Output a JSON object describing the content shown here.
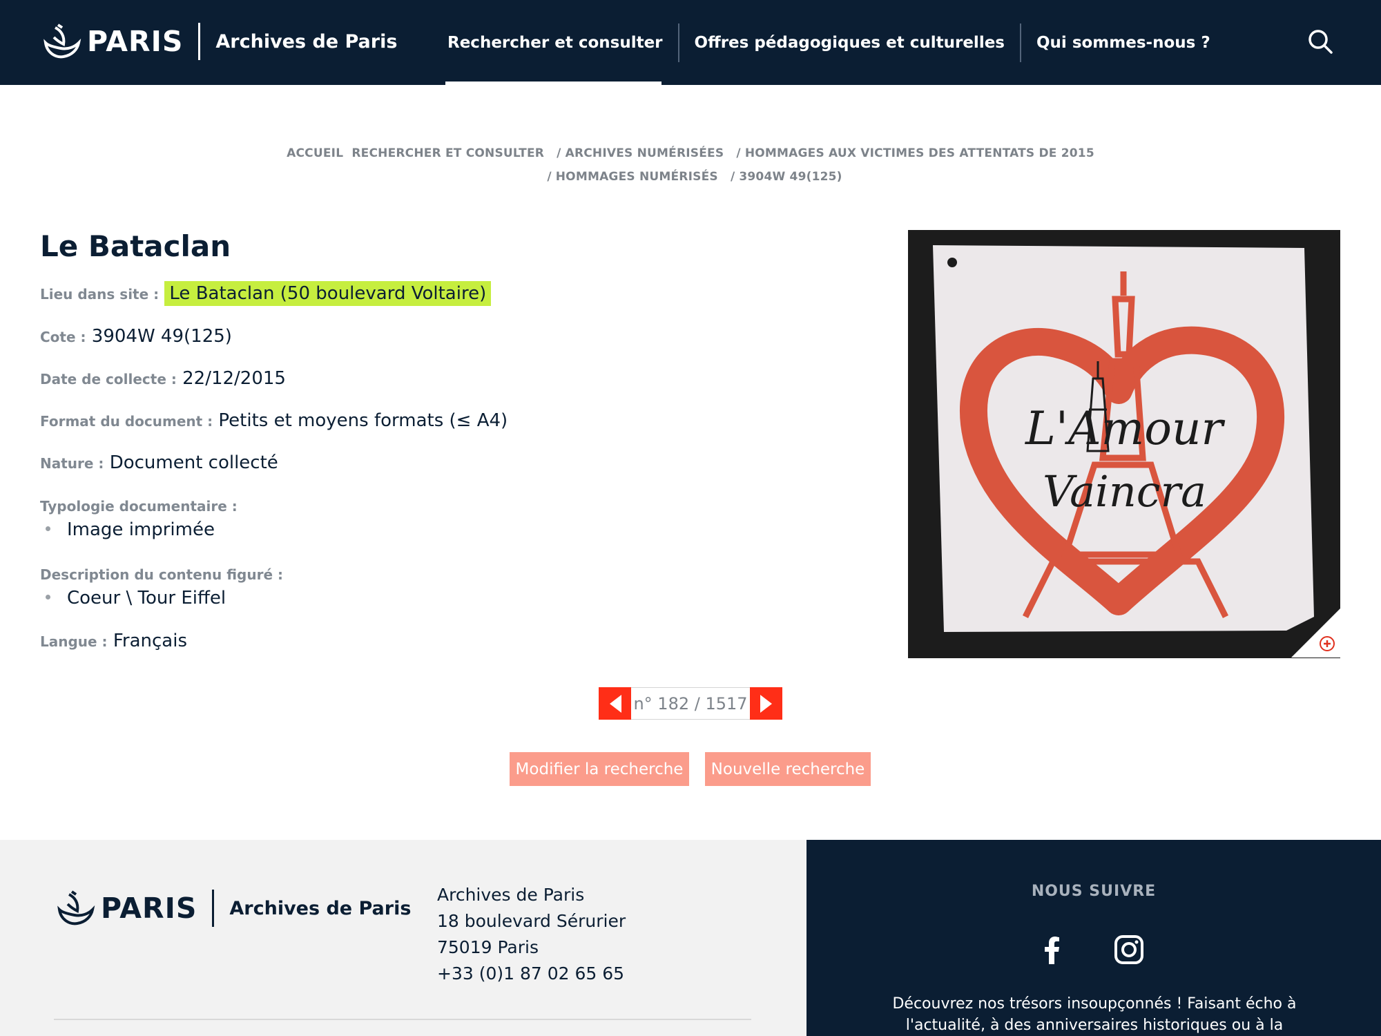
{
  "header": {
    "logo_text": "PARIS",
    "site_name": "Archives de Paris",
    "nav": [
      "Rechercher et consulter",
      "Offres pédagogiques et culturelles",
      "Qui sommes-nous ?"
    ],
    "search_icon": "search-icon"
  },
  "breadcrumb": {
    "line1": [
      "ACCUEIL",
      "RECHERCHER ET CONSULTER",
      "ARCHIVES NUMÉRISÉES",
      "HOMMAGES AUX VICTIMES DES ATTENTATS DE 2015"
    ],
    "line2": [
      "HOMMAGES NUMÉRISÉS",
      "3904W 49(125)"
    ],
    "separator": "/"
  },
  "record": {
    "title": "Le Bataclan",
    "lieu_label": "Lieu dans site :",
    "lieu_value": "Le Bataclan (50 boulevard Voltaire)",
    "cote_label": "Cote :",
    "cote_value": "3904W 49(125)",
    "date_label": "Date de collecte :",
    "date_value": "22/12/2015",
    "format_label": "Format du document :",
    "format_value": "Petits et moyens formats (≤ A4)",
    "nature_label": "Nature :",
    "nature_value": "Document collecté",
    "typologie_label": "Typologie documentaire :",
    "typologie_items": [
      "Image imprimée"
    ],
    "description_label": "Description du contenu figuré :",
    "description_items": [
      "Coeur \\ Tour Eiffel"
    ],
    "langue_label": "Langue :",
    "langue_value": "Français"
  },
  "image": {
    "handwriting_line1": "L'Amour",
    "handwriting_line2": "Vaincra",
    "heart_color": "#d9553e",
    "paper_color": "#ece8ea"
  },
  "pager": {
    "text": "n° 182 / 1517",
    "accent": "#ff2e17"
  },
  "actions": {
    "modify": "Modifier la recherche",
    "new": "Nouvelle recherche"
  },
  "footer": {
    "logo_text": "PARIS",
    "site_name": "Archives de Paris",
    "address": [
      "Archives de Paris",
      "18 boulevard Sérurier",
      "75019 Paris",
      "+33 (0)1 87 02 65 65"
    ],
    "follow_title": "NOUS SUIVRE",
    "follow_text": "Découvrez nos trésors insoupçonnés ! Faisant écho à l'actualité, à des anniversaires historiques ou à la",
    "social": [
      "facebook-icon",
      "instagram-icon"
    ]
  }
}
